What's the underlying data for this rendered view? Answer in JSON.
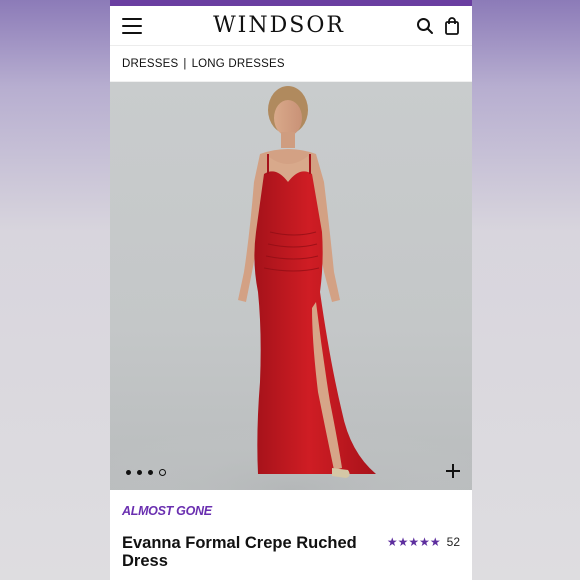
{
  "header": {
    "logo": "WINDSOR",
    "menu_icon": "hamburger-menu-icon",
    "search_icon": "search-icon",
    "bag_icon": "shopping-bag-icon"
  },
  "breadcrumb": {
    "items": [
      "DRESSES",
      "LONG DRESSES"
    ],
    "separator": "|"
  },
  "gallery": {
    "image": "model in red long ruched crepe dress with thigh-high slit",
    "dots": 4,
    "active_dot": 4,
    "expand_icon": "plus-icon"
  },
  "product": {
    "badge": "ALMOST GONE",
    "title": "Evanna Formal Crepe Ruched Dress",
    "rating_stars": "★★★★★",
    "rating_value": 5,
    "review_count": "52"
  },
  "colors": {
    "accent_purple": "#6a2fb0",
    "dress_red": "#c4161c"
  }
}
